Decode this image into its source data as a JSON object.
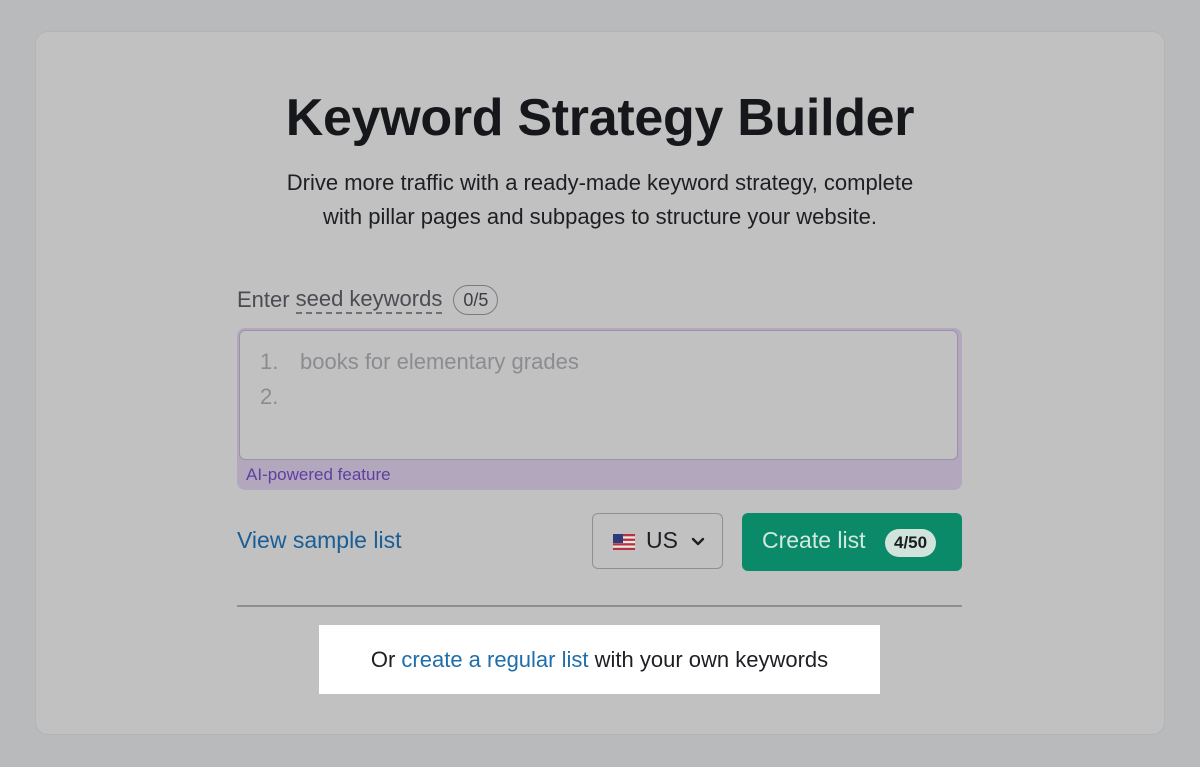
{
  "header": {
    "title": "Keyword Strategy Builder",
    "subtitle_line1": "Drive more traffic with a ready-made keyword strategy, complete",
    "subtitle_line2": "with pillar pages and subpages to structure your website."
  },
  "seed": {
    "prefix": "Enter",
    "link_label": "seed keywords",
    "count": "0/5"
  },
  "keywords_input": {
    "lines": [
      {
        "number": "1.",
        "placeholder": "books for elementary grades"
      },
      {
        "number": "2.",
        "placeholder": ""
      }
    ],
    "ai_label": "AI-powered feature"
  },
  "actions": {
    "view_sample_label": "View sample list",
    "country": {
      "flag_icon": "us-flag-icon",
      "code": "US"
    },
    "create_label": "Create list",
    "create_limit": "4/50"
  },
  "footer": {
    "prefix": "Or ",
    "link_label": "create a regular list",
    "suffix": " with your own keywords"
  },
  "colors": {
    "background": "#b9babc",
    "card": "#c1c1c1",
    "primary_button": "#0b8a6a",
    "link": "#1a5e96",
    "ai_accent": "#5e3fa0",
    "highlight": "#ffffff"
  }
}
